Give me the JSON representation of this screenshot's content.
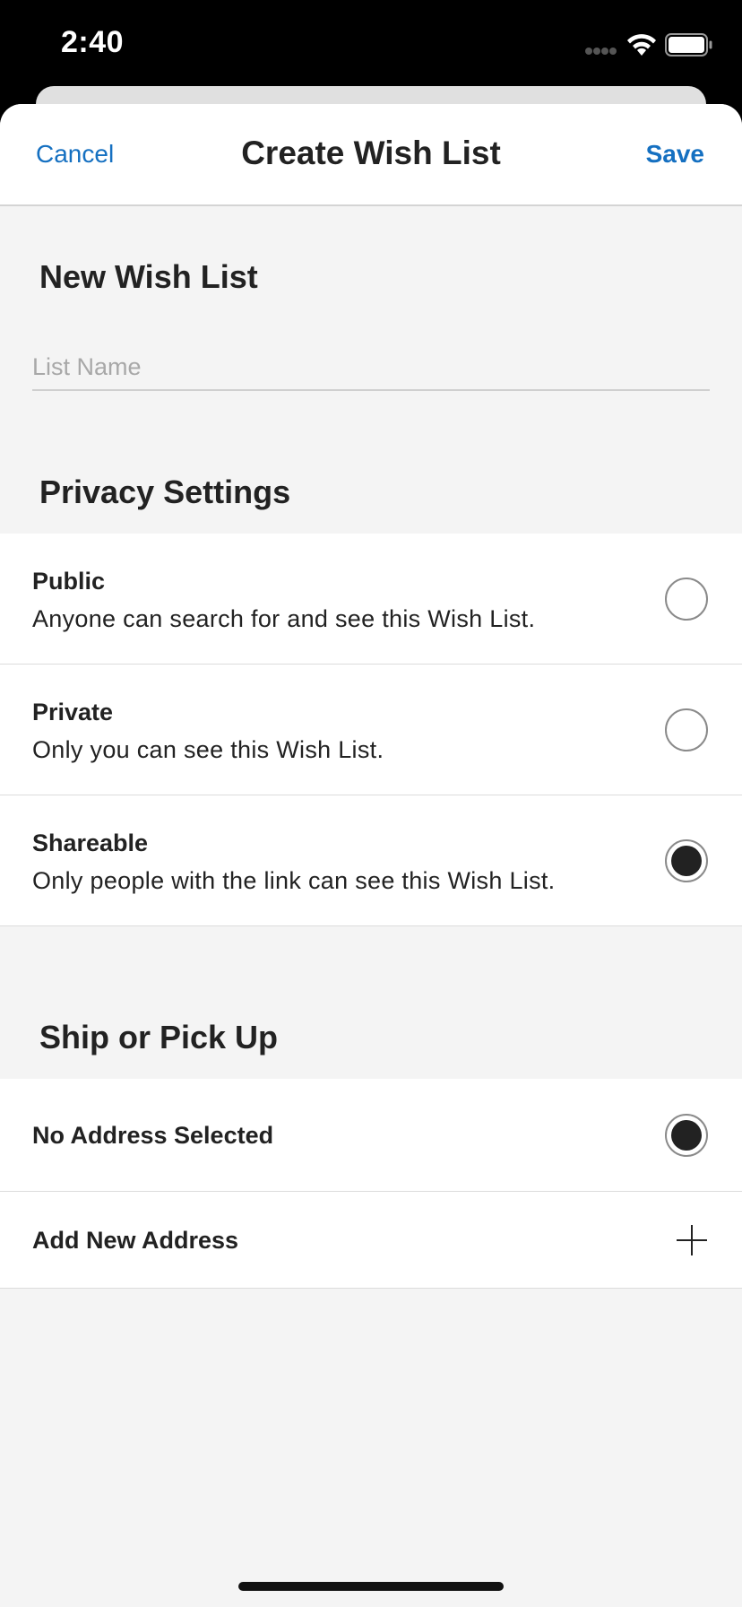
{
  "status_bar": {
    "time": "2:40",
    "signal_icon": "signal-dots-icon",
    "wifi_icon": "wifi-icon",
    "battery_icon": "battery-icon"
  },
  "nav": {
    "cancel_label": "Cancel",
    "title": "Create Wish List",
    "save_label": "Save"
  },
  "new_list": {
    "heading": "New Wish List",
    "name_placeholder": "List Name",
    "name_value": ""
  },
  "privacy": {
    "heading": "Privacy Settings",
    "options": [
      {
        "title": "Public",
        "description": "Anyone can search for and see this Wish List.",
        "selected": false
      },
      {
        "title": "Private",
        "description": "Only you can see this Wish List.",
        "selected": false
      },
      {
        "title": "Shareable",
        "description": "Only people with the link can see this Wish List.",
        "selected": true
      }
    ]
  },
  "shipping": {
    "heading": "Ship or Pick Up",
    "address_label": "No Address Selected",
    "address_selected": true,
    "add_address_label": "Add New Address",
    "add_icon": "plus-icon"
  },
  "colors": {
    "accent": "#1570c1",
    "text": "#222222",
    "background": "#f4f4f4",
    "placeholder": "#a8a8a8"
  }
}
